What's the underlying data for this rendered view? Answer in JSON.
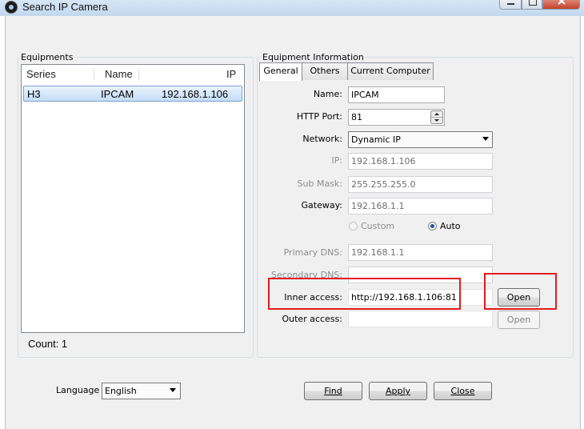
{
  "window": {
    "title": "Search IP Camera"
  },
  "equipments": {
    "group_label": "Equipments",
    "columns": [
      "Series",
      "Name",
      "IP"
    ],
    "rows": [
      {
        "series": "H3",
        "name": "IPCAM",
        "ip": "192.168.1.106"
      }
    ],
    "count_text": "Count: 1"
  },
  "info": {
    "group_label": "Equipment Information",
    "tabs": [
      "General",
      "Others",
      "Current Computer"
    ],
    "name_label": "Name:",
    "name_value": "IPCAM",
    "port_label": "HTTP Port:",
    "port_value": "81",
    "network_label": "Network:",
    "network_value": "Dynamic IP",
    "ip_label": "IP:",
    "ip_value": "192.168.1.106",
    "mask_label": "Sub Mask:",
    "mask_value": "255.255.255.0",
    "gateway_label": "Gateway:",
    "gateway_value": "192.168.1.1",
    "dns_custom_label": "Custom",
    "dns_auto_label": "Auto",
    "pdns_label": "Primary DNS:",
    "pdns_value": "192.168.1.1",
    "sdns_label": "Secondary DNS:",
    "sdns_value": "",
    "inner_label": "Inner access:",
    "inner_value": "http://192.168.1.106:81",
    "outer_label": "Outer access:",
    "outer_value": "",
    "open_label": "Open"
  },
  "footer": {
    "language_label": "Language",
    "language_value": "English",
    "find_label": "Find",
    "apply_label": "Apply",
    "close_label": "Close"
  },
  "colors": {
    "highlight_red": "#e31b1b",
    "selection": "#c4ddf7",
    "titlebar": "#c3d8ee"
  },
  "icons": [
    "camera-app-icon",
    "minimize-icon",
    "maximize-icon",
    "close-icon",
    "dropdown-arrow-icon",
    "spin-up-icon",
    "spin-down-icon"
  ]
}
